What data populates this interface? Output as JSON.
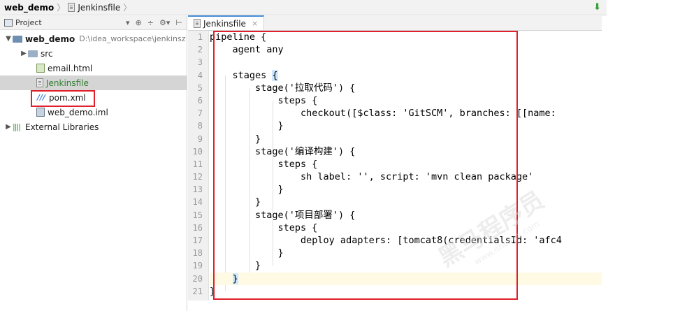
{
  "breadcrumb": {
    "project": "web_demo",
    "file": "Jenkinsfile"
  },
  "project_panel": {
    "title": "Project"
  },
  "tree": {
    "root": {
      "name": "web_demo",
      "path": "D:\\idea_workspace\\jenkinsz"
    },
    "items": [
      {
        "label": "src"
      },
      {
        "label": "email.html"
      },
      {
        "label": "Jenkinsfile"
      },
      {
        "label": "pom.xml"
      },
      {
        "label": "web_demo.iml"
      }
    ],
    "external": "External Libraries"
  },
  "editor": {
    "tab_label": "Jenkinsfile",
    "line_numbers": [
      "1",
      "2",
      "3",
      "4",
      "5",
      "6",
      "7",
      "8",
      "9",
      "10",
      "11",
      "12",
      "13",
      "14",
      "15",
      "16",
      "17",
      "18",
      "19",
      "20",
      "21"
    ],
    "lines": [
      "pipeline {",
      "    agent any",
      "",
      "    stages {",
      "        stage('拉取代码') {",
      "            steps {",
      "                checkout([$class: 'GitSCM', branches: [[name:",
      "            }",
      "        }",
      "        stage('编译构建') {",
      "            steps {",
      "                sh label: '', script: 'mvn clean package'",
      "            }",
      "        }",
      "        stage('项目部署') {",
      "            steps {",
      "                deploy adapters: [tomcat8(credentialsId: 'afc4",
      "            }",
      "        }",
      "    }",
      "}"
    ]
  },
  "watermark": {
    "text": "黑马程序员",
    "sub": "www.itheima.com"
  }
}
